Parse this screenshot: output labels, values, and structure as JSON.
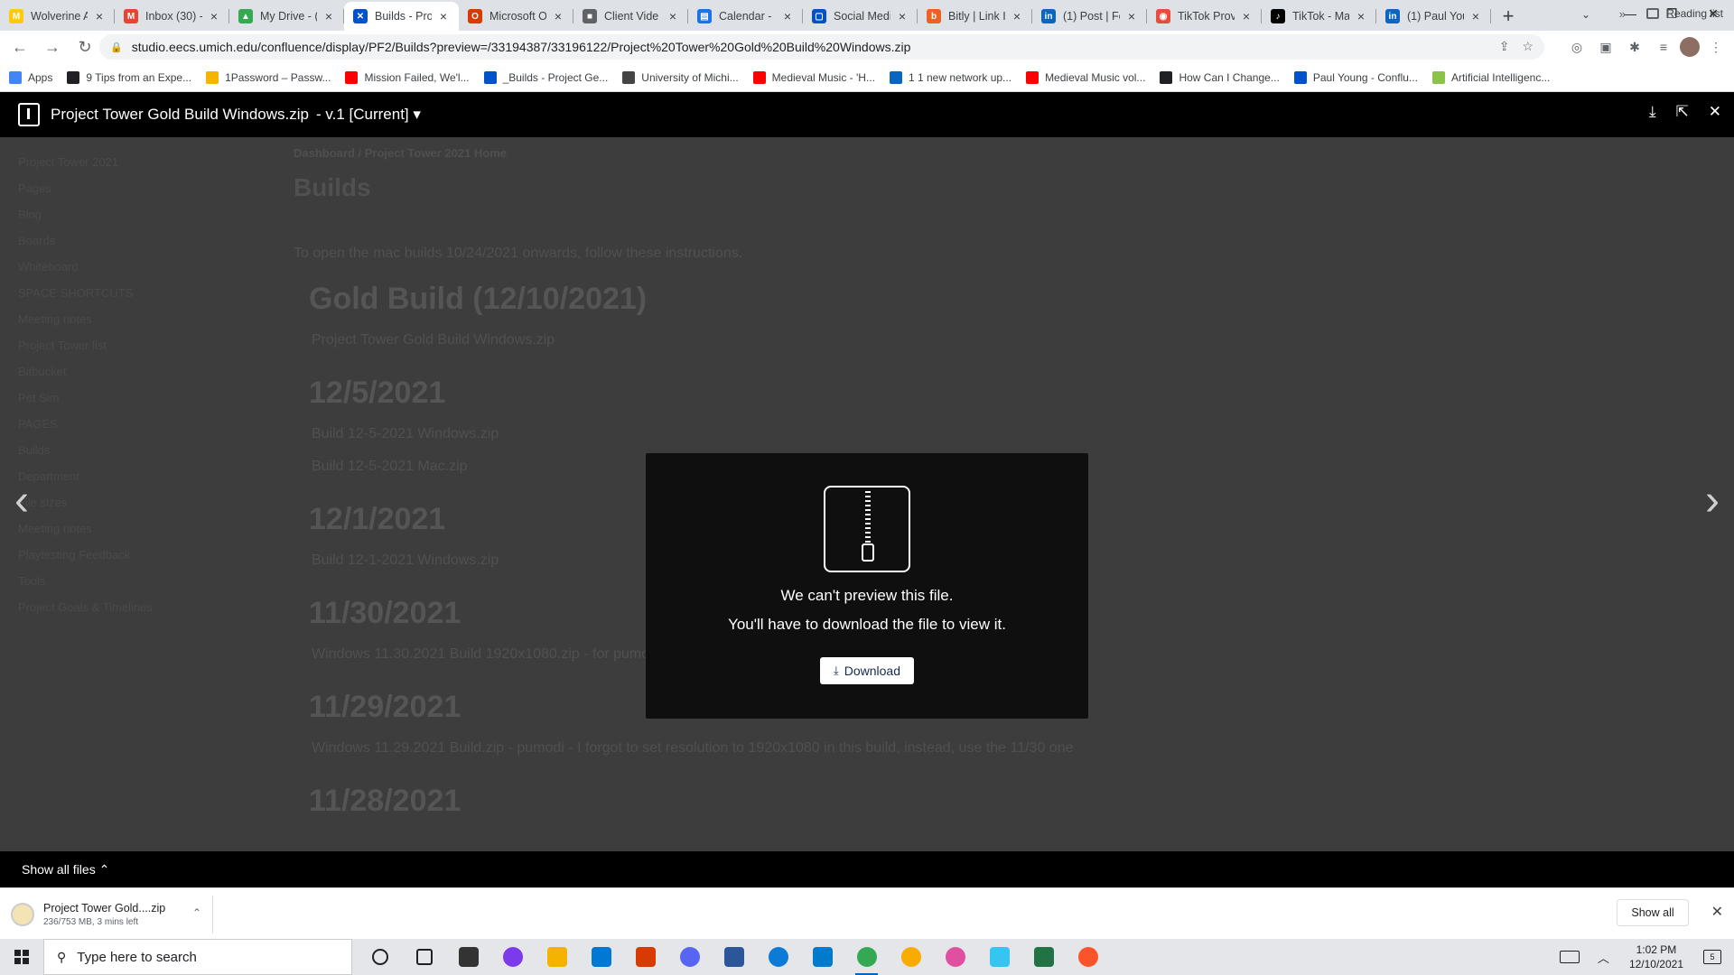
{
  "browser": {
    "tabs": [
      {
        "label": "Wolverine A",
        "color": "#ffcb05",
        "glyph": "M",
        "active": false
      },
      {
        "label": "Inbox (30) -",
        "color": "#ea4335",
        "glyph": "M",
        "active": false
      },
      {
        "label": "My Drive - (",
        "color": "#34a853",
        "glyph": "▲",
        "active": false
      },
      {
        "label": "Builds - Pro",
        "color": "#0052cc",
        "glyph": "✕",
        "active": true
      },
      {
        "label": "Microsoft O",
        "color": "#d83b01",
        "glyph": "O",
        "active": false
      },
      {
        "label": "Client Vide",
        "color": "#5f6368",
        "glyph": "■",
        "active": false
      },
      {
        "label": "Calendar - I",
        "color": "#1a73e8",
        "glyph": "▤",
        "active": false
      },
      {
        "label": "Social Medi",
        "color": "#0052cc",
        "glyph": "▢",
        "active": false
      },
      {
        "label": "Bitly | Link I",
        "color": "#ee6123",
        "glyph": "b",
        "active": false
      },
      {
        "label": "(1) Post | Fe",
        "color": "#0a66c2",
        "glyph": "in",
        "active": false
      },
      {
        "label": "TikTok Prov",
        "color": "#e84c3d",
        "glyph": "◉",
        "active": false
      },
      {
        "label": "TikTok - Ma",
        "color": "#000000",
        "glyph": "♪",
        "active": false
      },
      {
        "label": "(1) Paul You",
        "color": "#0a66c2",
        "glyph": "in",
        "active": false
      }
    ],
    "new_tab_label": "+",
    "url": "studio.eecs.umich.edu/confluence/display/PF2/Builds?preview=/33194387/33196122/Project%20Tower%20Gold%20Build%20Windows.zip",
    "bookmarks": [
      {
        "label": "Apps",
        "color": "#4285f4"
      },
      {
        "label": "9 Tips from an Expe...",
        "color": "#202124"
      },
      {
        "label": "1Password – Passw...",
        "color": "#f4b400"
      },
      {
        "label": "Mission Failed, We'l...",
        "color": "#ff0000"
      },
      {
        "label": "_Builds - Project Ge...",
        "color": "#0052cc"
      },
      {
        "label": "University of Michi...",
        "color": "#444444"
      },
      {
        "label": "Medieval Music - 'H...",
        "color": "#ff0000"
      },
      {
        "label": "1 1 new network up...",
        "color": "#0a66c2"
      },
      {
        "label": "Medieval Music vol...",
        "color": "#ff0000"
      },
      {
        "label": "How Can I Change...",
        "color": "#202124"
      },
      {
        "label": "Paul Young - Conflu...",
        "color": "#0052cc"
      },
      {
        "label": "Artificial Intelligenc...",
        "color": "#8bc34a"
      }
    ],
    "bookmarks_more": "»",
    "reading_list": "Reading list"
  },
  "viewer": {
    "file_title": "Project Tower Gold Build Windows.zip",
    "version": "- v.1 [Current]",
    "dialog_line1": "We can't preview this file.",
    "dialog_line2": "You'll have to download the file to view it.",
    "download_label": "Download"
  },
  "background_page": {
    "sidebar": [
      "Project Tower 2021",
      "Pages",
      "Blog",
      "Boards",
      "Whiteboard",
      "SPACE SHORTCUTS",
      "Meeting notes",
      "Project Tower list",
      "Bitbucket",
      "Pet Sim",
      "PAGES",
      "Builds",
      "Department",
      "File sizes",
      "Meeting notes",
      "Playtesting Feedback",
      "Tools",
      "Project Goals & Timelines"
    ],
    "breadcrumb": "Dashboard  /  Project Tower 2021 Home",
    "title": "Builds",
    "intro": "To open the mac builds 10/24/2021 onwards, follow these instructions.",
    "sections": [
      {
        "heading": "Gold Build (12/10/2021)",
        "lines": [
          "Project Tower Gold Build Windows.zip"
        ]
      },
      {
        "heading": "12/5/2021",
        "lines": [
          "Build 12-5-2021 Windows.zip",
          "Build 12-5-2021 Mac.zip"
        ]
      },
      {
        "heading": "12/1/2021",
        "lines": [
          "Build 12-1-2021 Windows.zip"
        ]
      },
      {
        "heading": "11/30/2021",
        "lines": [
          "Windows 11.30.2021 Build 1920x1080.zip - for pumodi"
        ]
      },
      {
        "heading": "11/29/2021",
        "lines": [
          "Windows 11.29.2021 Build.zip - pumodi - I forgot to set resolution to 1920x1080 in this build, instead, use the 11/30 one"
        ]
      },
      {
        "heading": "11/28/2021",
        "lines": []
      }
    ]
  },
  "show_all_files": "Show all files",
  "downloads": {
    "item_name": "Project Tower Gold....zip",
    "item_status": "236/753 MB, 3 mins left",
    "show_all": "Show all"
  },
  "taskbar": {
    "search_placeholder": "Type here to search",
    "apps": [
      {
        "name": "task-view-icon",
        "color": "#202124"
      },
      {
        "name": "widgets-icon",
        "color": "#202124"
      },
      {
        "name": "store-icon",
        "color": "#333333"
      },
      {
        "name": "podcast-icon",
        "color": "#7c3aed"
      },
      {
        "name": "file-explorer-icon",
        "color": "#f3b300"
      },
      {
        "name": "mail-icon",
        "color": "#0078d4"
      },
      {
        "name": "office-icon",
        "color": "#d83b01"
      },
      {
        "name": "discord-icon",
        "color": "#5865f2"
      },
      {
        "name": "word-icon",
        "color": "#2b579a"
      },
      {
        "name": "edge-icon",
        "color": "#0c7bd8"
      },
      {
        "name": "vscode-icon",
        "color": "#007acc"
      },
      {
        "name": "chrome-icon",
        "color": "#34a853"
      },
      {
        "name": "chrome-canary-icon",
        "color": "#f9ab00"
      },
      {
        "name": "itunes-icon",
        "color": "#e04fa0"
      },
      {
        "name": "slack-icon",
        "color": "#36c5f0"
      },
      {
        "name": "excel-icon",
        "color": "#217346"
      },
      {
        "name": "brave-icon",
        "color": "#fb542b"
      }
    ],
    "time": "1:02 PM",
    "date": "12/10/2021",
    "notification_count": "5"
  }
}
